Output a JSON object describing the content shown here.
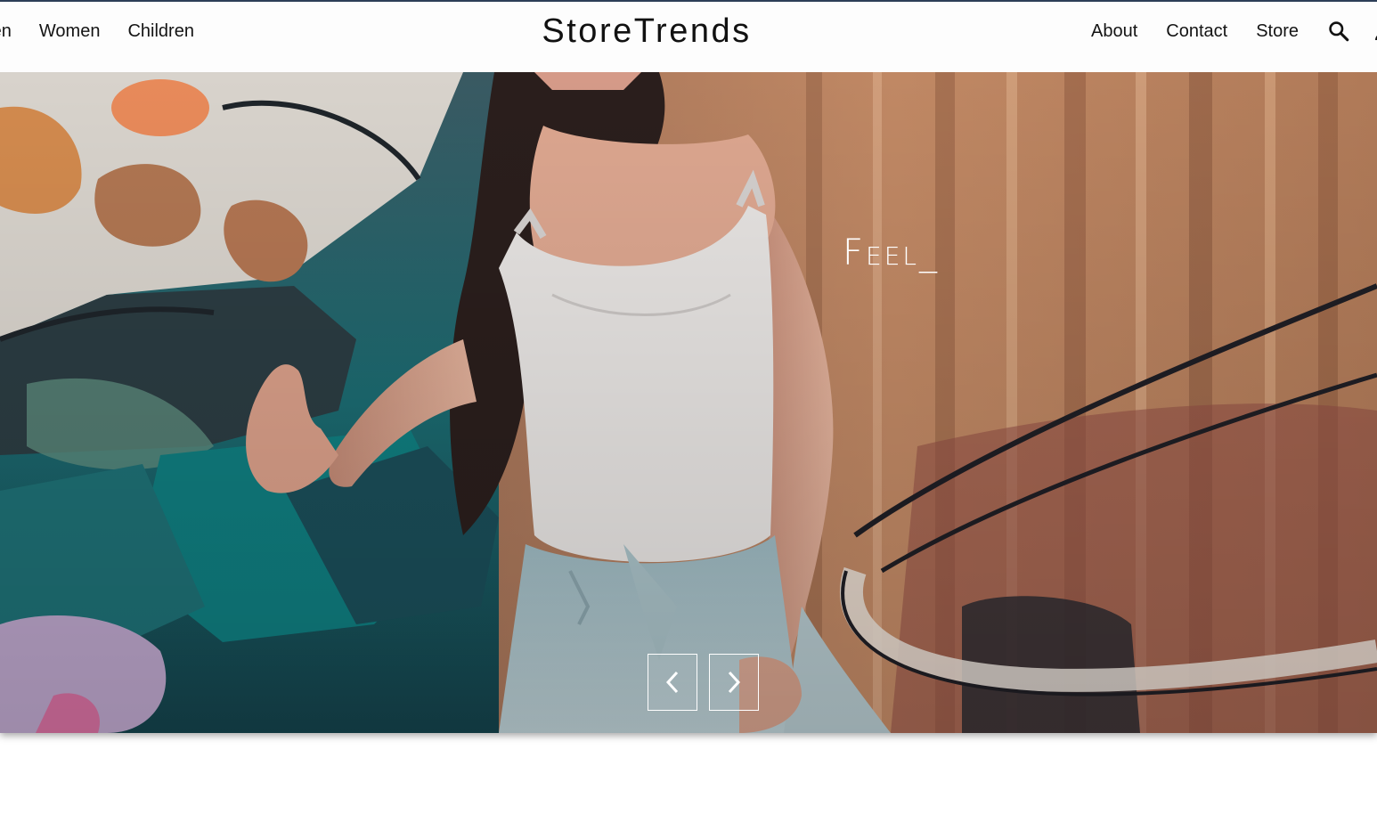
{
  "header": {
    "brand": "StoreTrends",
    "left_nav": [
      {
        "label": "Men"
      },
      {
        "label": "Women"
      },
      {
        "label": "Children"
      }
    ],
    "right_nav": [
      {
        "label": "About"
      },
      {
        "label": "Contact"
      },
      {
        "label": "Store"
      }
    ],
    "icons": {
      "search": "search-icon",
      "account": "account-icon"
    }
  },
  "hero": {
    "headline": "Feel_",
    "prev_icon": "chevron-left-icon",
    "next_icon": "chevron-right-icon"
  },
  "colors": {
    "accent_line": "#2c3e57",
    "header_bg": "#fdfdfd",
    "text": "#141414",
    "hero_text": "#ffffff"
  }
}
